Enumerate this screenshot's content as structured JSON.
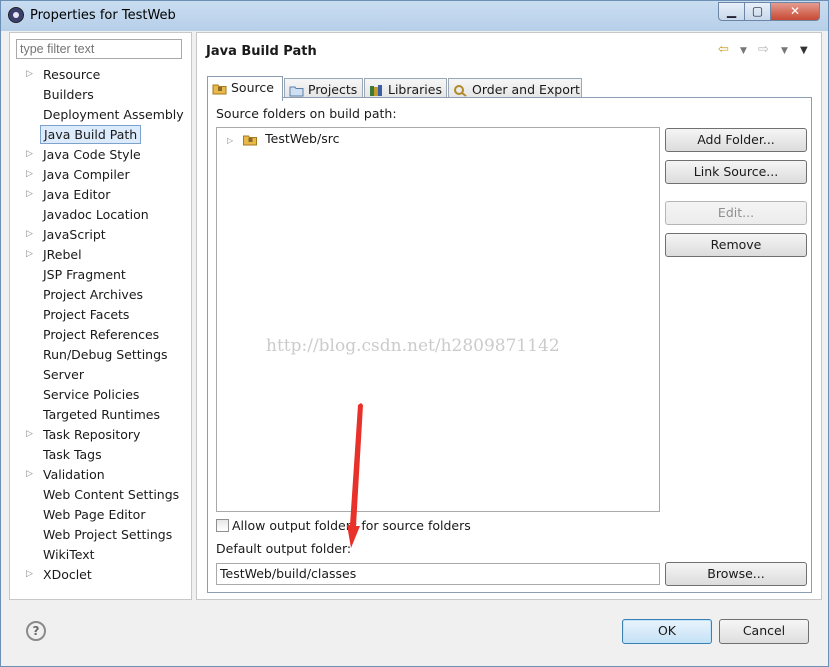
{
  "window": {
    "title": "Properties for TestWeb",
    "controls": {
      "minimize": "▁",
      "maximize": "▢",
      "close": "✕"
    }
  },
  "filter": {
    "placeholder": "type filter text"
  },
  "nav_items": [
    {
      "label": "Resource",
      "expandable": true
    },
    {
      "label": "Builders",
      "expandable": false
    },
    {
      "label": "Deployment Assembly",
      "expandable": false
    },
    {
      "label": "Java Build Path",
      "expandable": false,
      "selected": true
    },
    {
      "label": "Java Code Style",
      "expandable": true
    },
    {
      "label": "Java Compiler",
      "expandable": true
    },
    {
      "label": "Java Editor",
      "expandable": true
    },
    {
      "label": "Javadoc Location",
      "expandable": false
    },
    {
      "label": "JavaScript",
      "expandable": true
    },
    {
      "label": "JRebel",
      "expandable": true
    },
    {
      "label": "JSP Fragment",
      "expandable": false
    },
    {
      "label": "Project Archives",
      "expandable": false
    },
    {
      "label": "Project Facets",
      "expandable": false
    },
    {
      "label": "Project References",
      "expandable": false
    },
    {
      "label": "Run/Debug Settings",
      "expandable": false
    },
    {
      "label": "Server",
      "expandable": false
    },
    {
      "label": "Service Policies",
      "expandable": false
    },
    {
      "label": "Targeted Runtimes",
      "expandable": false
    },
    {
      "label": "Task Repository",
      "expandable": true
    },
    {
      "label": "Task Tags",
      "expandable": false
    },
    {
      "label": "Validation",
      "expandable": true
    },
    {
      "label": "Web Content Settings",
      "expandable": false
    },
    {
      "label": "Web Page Editor",
      "expandable": false
    },
    {
      "label": "Web Project Settings",
      "expandable": false
    },
    {
      "label": "WikiText",
      "expandable": false
    },
    {
      "label": "XDoclet",
      "expandable": true
    }
  ],
  "page": {
    "title": "Java Build Path",
    "tabs": [
      {
        "label": "Source",
        "icon": "source-folder-icon",
        "active": true
      },
      {
        "label": "Projects",
        "icon": "projects-icon"
      },
      {
        "label": "Libraries",
        "icon": "libraries-icon"
      },
      {
        "label": "Order and Export",
        "icon": "order-export-icon"
      }
    ],
    "source_label": "Source folders on build path:",
    "source_folders": [
      "TestWeb/src"
    ],
    "buttons": {
      "add_folder": "Add Folder...",
      "link_source": "Link Source...",
      "edit": "Edit...",
      "remove": "Remove",
      "browse": "Browse..."
    },
    "allow_output_label": "Allow output folders for source folders",
    "default_output_label": "Default output folder:",
    "default_output_value": "TestWeb/build/classes",
    "watermark": "http://blog.csdn.net/h2809871142"
  },
  "footer": {
    "help": "?",
    "ok": "OK",
    "cancel": "Cancel"
  },
  "colors": {
    "accent": "#3c7fb1",
    "selection": "#dcebfc",
    "annotation_arrow": "#e8312a"
  }
}
